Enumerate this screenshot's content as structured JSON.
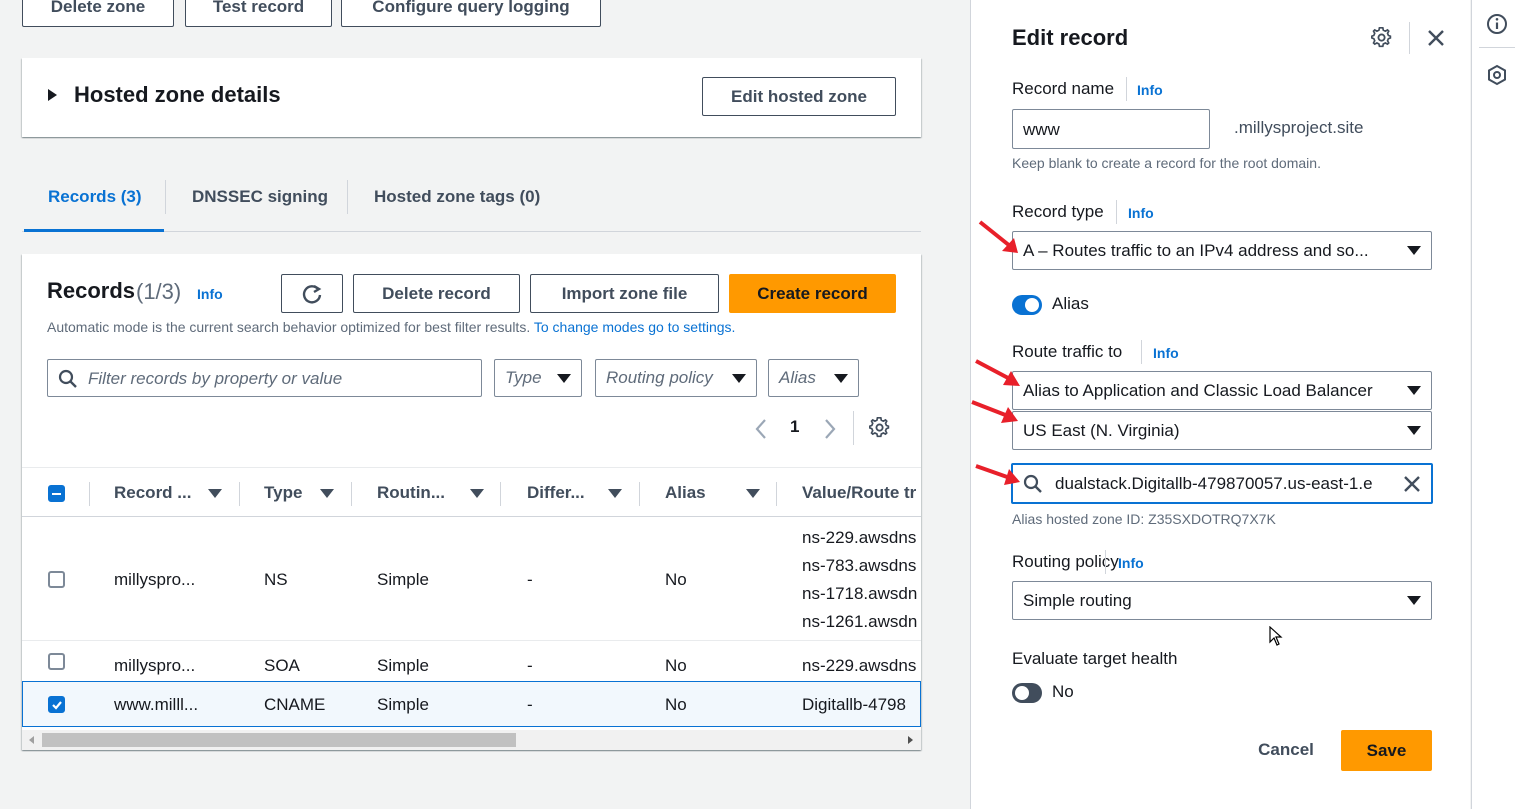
{
  "toolbar": {
    "delete_zone": "Delete zone",
    "test_record": "Test record",
    "configure_logging": "Configure query logging"
  },
  "hosted_zone_details": {
    "title": "Hosted zone details",
    "edit_button": "Edit hosted zone"
  },
  "tabs": [
    {
      "label": "Records (3)",
      "active": true
    },
    {
      "label": "DNSSEC signing",
      "active": false
    },
    {
      "label": "Hosted zone tags (0)",
      "active": false
    }
  ],
  "records": {
    "title": "Records",
    "count": "(1/3)",
    "info": "Info",
    "delete_button": "Delete record",
    "import_button": "Import zone file",
    "create_button": "Create record",
    "mode_text": "Automatic mode is the current search behavior optimized for best filter results.",
    "mode_link": "To change modes go to settings.",
    "filter_placeholder": "Filter records by property or value",
    "filter_type": "Type",
    "filter_routing": "Routing policy",
    "filter_alias": "Alias",
    "page_number": "1",
    "columns": [
      "Record ...",
      "Type",
      "Routin...",
      "Differ...",
      "Alias",
      "Value/Route tr"
    ],
    "rows": [
      {
        "name": "millyspro...",
        "type": "NS",
        "routing": "Simple",
        "differ": "-",
        "alias": "No",
        "values": [
          "ns-229.awsdns",
          "ns-783.awsdns",
          "ns-1718.awsdn",
          "ns-1261.awsdn"
        ],
        "checked": false
      },
      {
        "name": "millyspro...",
        "type": "SOA",
        "routing": "Simple",
        "differ": "-",
        "alias": "No",
        "values": [
          "ns-229.awsdns"
        ],
        "checked": false
      },
      {
        "name": "www.milll...",
        "type": "CNAME",
        "routing": "Simple",
        "differ": "-",
        "alias": "No",
        "values": [
          "Digitallb-4798"
        ],
        "checked": true
      }
    ]
  },
  "edit_panel": {
    "title": "Edit record",
    "record_name_label": "Record name",
    "info": "Info",
    "record_name_value": "www",
    "domain_suffix": ".millysproject.site",
    "record_name_hint": "Keep blank to create a record for the root domain.",
    "record_type_label": "Record type",
    "record_type_value": "A – Routes traffic to an IPv4 address and so...",
    "alias_label": "Alias",
    "alias_on": true,
    "route_traffic_label": "Route traffic to",
    "route_target": "Alias to Application and Classic Load Balancer",
    "region": "US East (N. Virginia)",
    "endpoint_value": "dualstack.Digitallb-479870057.us-east-1.e",
    "hosted_zone_id": "Alias hosted zone ID: Z35SXDOTRQ7X7K",
    "routing_policy_label": "Routing policy",
    "routing_policy_value": "Simple routing",
    "evaluate_health_label": "Evaluate target health",
    "evaluate_health_value": "No",
    "evaluate_health_on": false,
    "cancel": "Cancel",
    "save": "Save"
  },
  "colors": {
    "accent": "#0972d3",
    "primary": "#ff9900",
    "annotation": "#e8202a"
  }
}
